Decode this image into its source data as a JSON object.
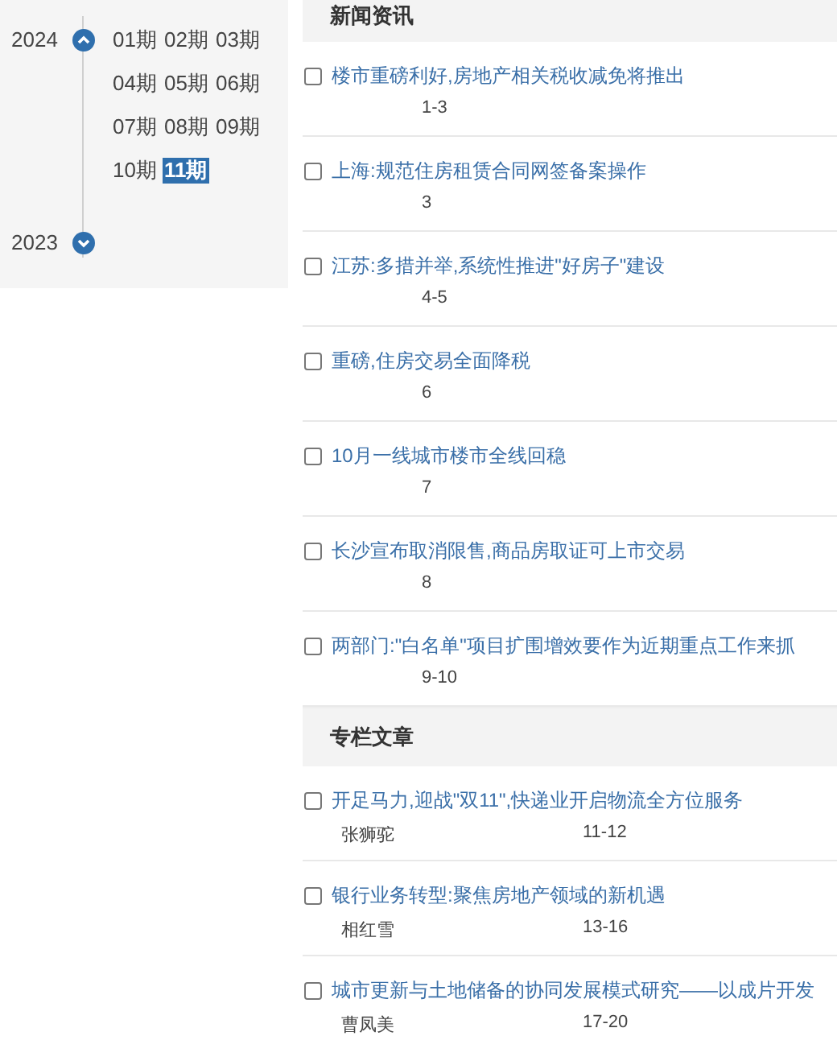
{
  "sidebar": {
    "years": [
      {
        "year": "2024",
        "expanded": true,
        "issues": [
          {
            "label": "01期",
            "selected": false
          },
          {
            "label": "02期",
            "selected": false
          },
          {
            "label": "03期",
            "selected": false
          },
          {
            "label": "04期",
            "selected": false
          },
          {
            "label": "05期",
            "selected": false
          },
          {
            "label": "06期",
            "selected": false
          },
          {
            "label": "07期",
            "selected": false
          },
          {
            "label": "08期",
            "selected": false
          },
          {
            "label": "09期",
            "selected": false
          },
          {
            "label": "10期",
            "selected": false
          },
          {
            "label": "11期",
            "selected": true
          }
        ]
      },
      {
        "year": "2023",
        "expanded": false
      }
    ]
  },
  "sections": [
    {
      "title": "新闻资讯",
      "items": [
        {
          "title": "楼市重磅利好,房地产相关税收减免将推出",
          "pages": "1-3",
          "checked": false
        },
        {
          "title": "上海:规范住房租赁合同网签备案操作",
          "pages": "3",
          "checked": false
        },
        {
          "title": "江苏:多措并举,系统性推进\"好房子\"建设",
          "pages": "4-5",
          "checked": false
        },
        {
          "title": "重磅,住房交易全面降税",
          "pages": "6",
          "checked": false
        },
        {
          "title": "10月一线城市楼市全线回稳",
          "pages": "7",
          "checked": false
        },
        {
          "title": "长沙宣布取消限售,商品房取证可上市交易",
          "pages": "8",
          "checked": false
        },
        {
          "title": "两部门:\"白名单\"项目扩围增效要作为近期重点工作来抓",
          "pages": "9-10",
          "checked": false
        }
      ]
    },
    {
      "title": "专栏文章",
      "items": [
        {
          "title": "开足马力,迎战\"双11\",快递业开启物流全方位服务",
          "author": "张狮驼",
          "pages": "11-12",
          "checked": false
        },
        {
          "title": "银行业务转型:聚焦房地产领域的新机遇",
          "author": "相红雪",
          "pages": "13-16",
          "checked": false
        },
        {
          "title": "城市更新与土地储备的协同发展模式研究——以成片开发",
          "author": "曹凤美",
          "pages": "17-20",
          "checked": false
        }
      ]
    }
  ]
}
